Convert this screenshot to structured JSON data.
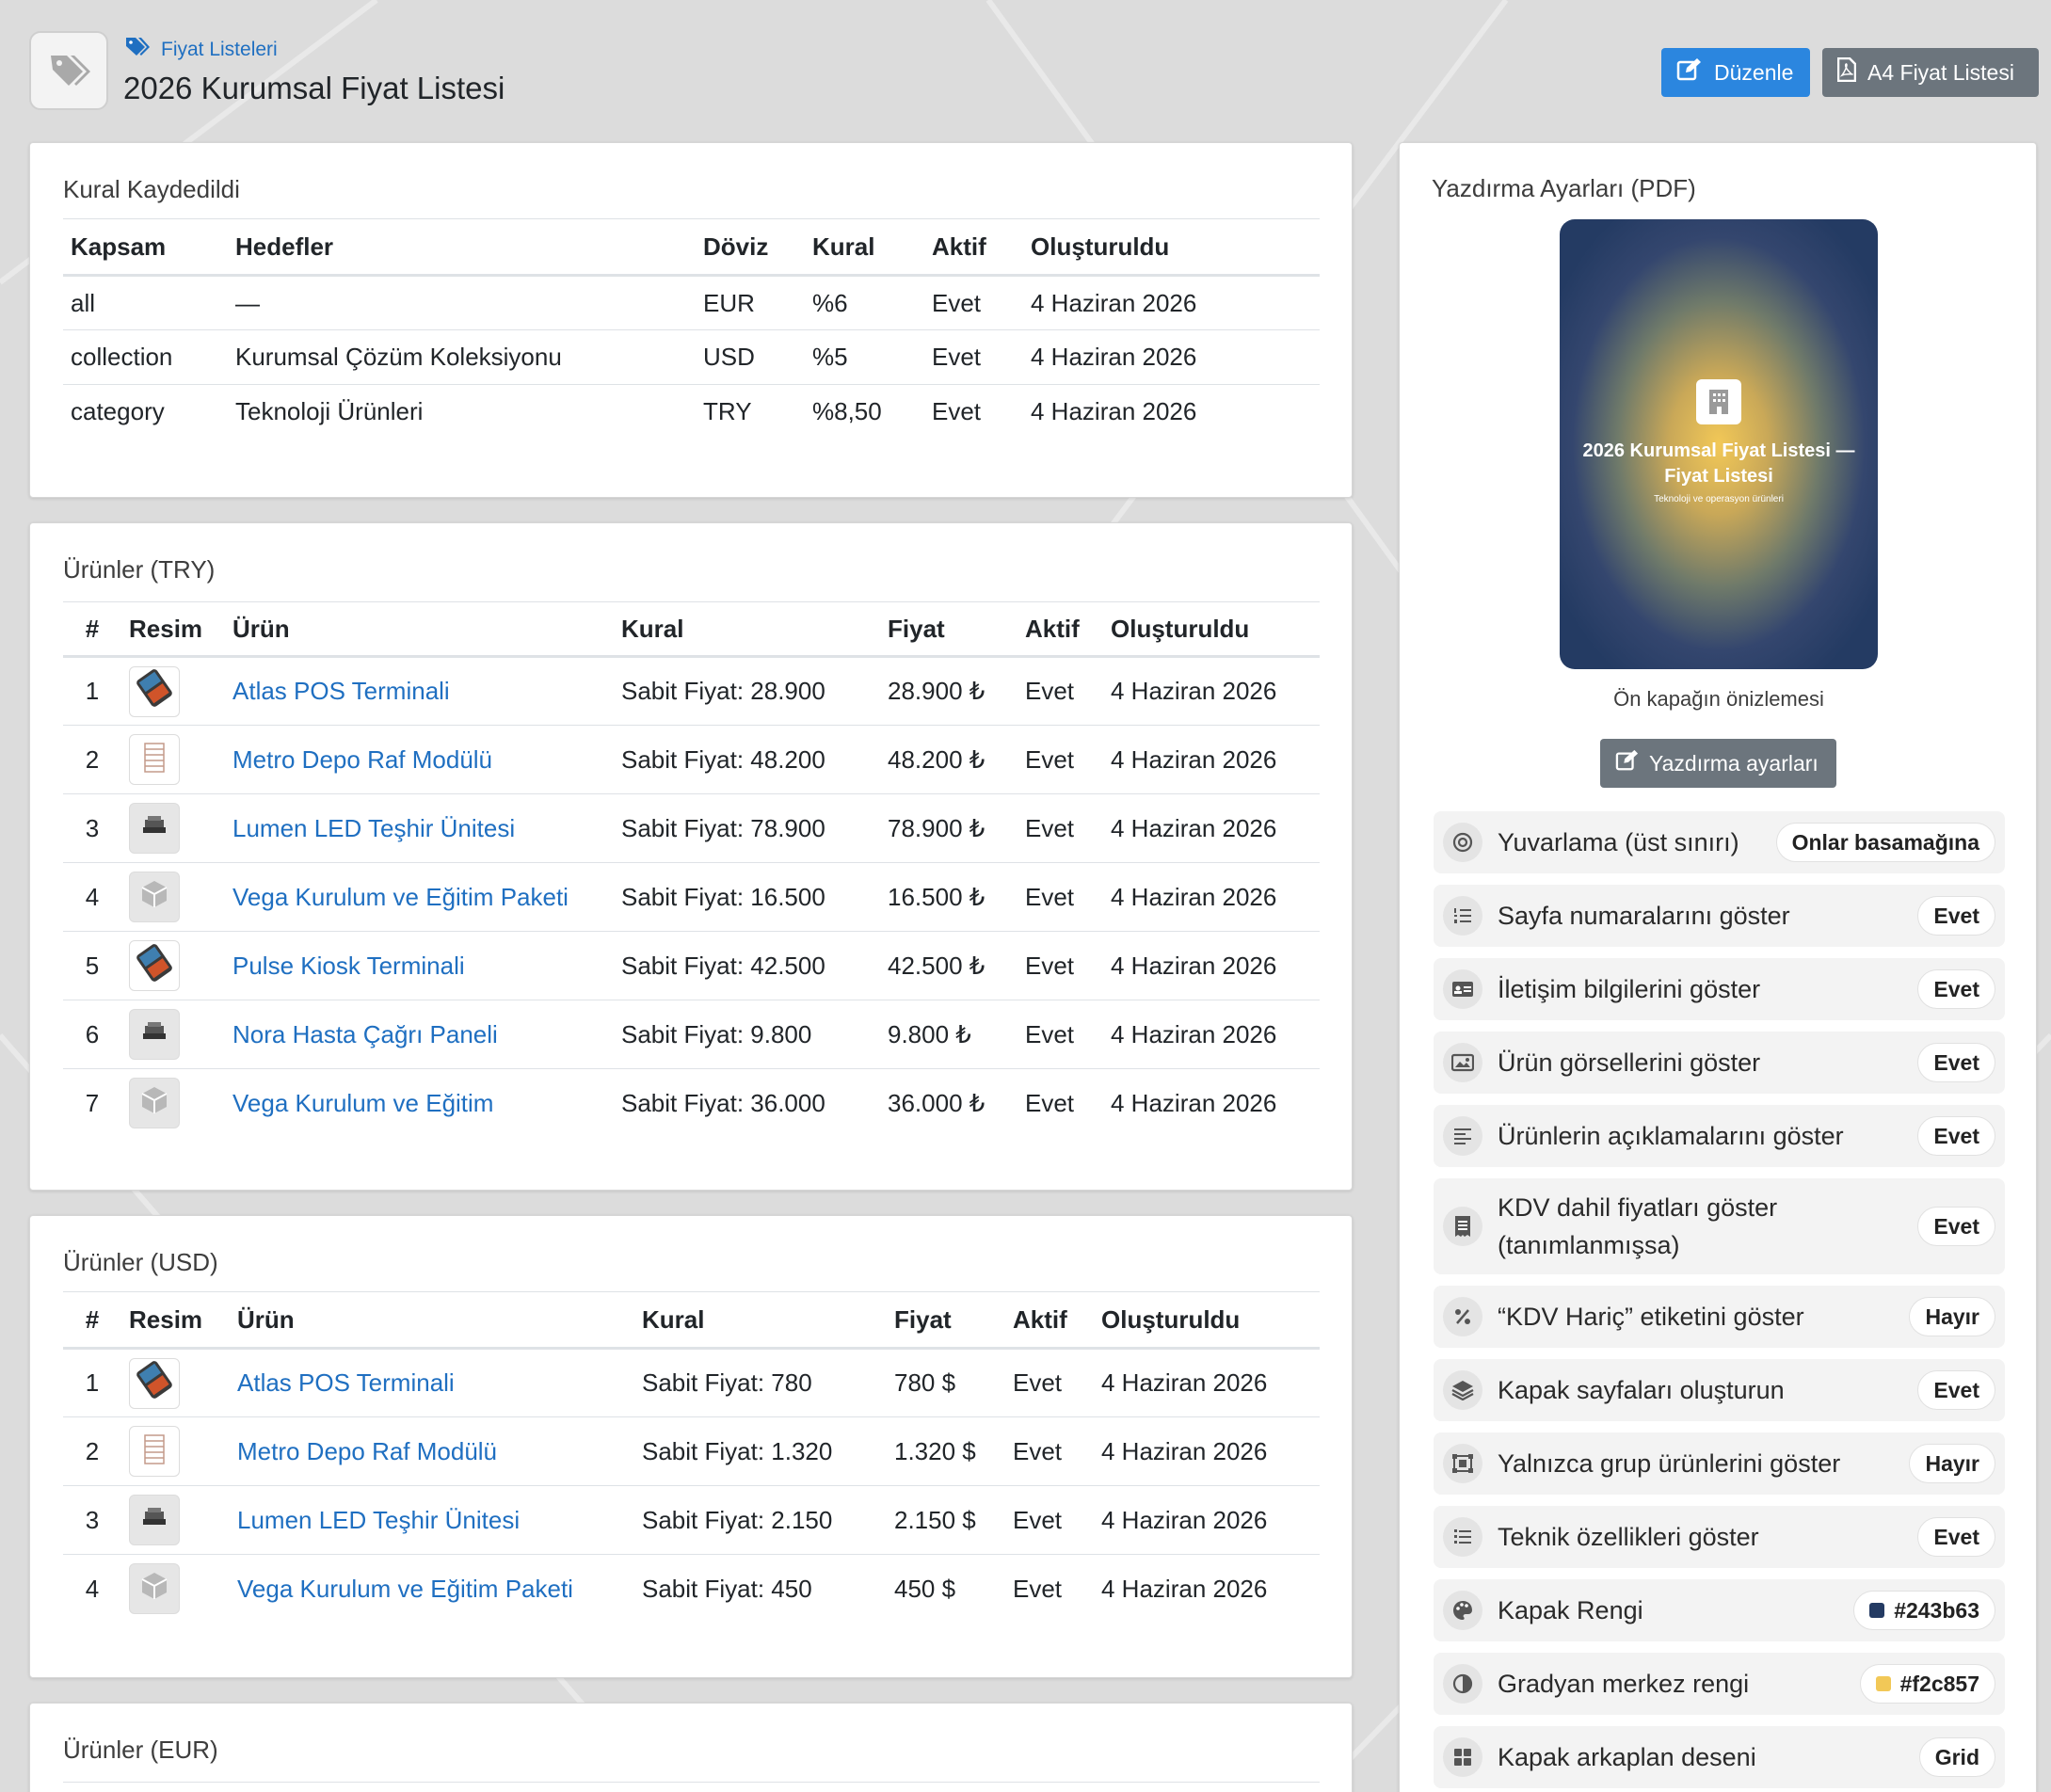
{
  "header": {
    "breadcrumb": "Fiyat Listeleri",
    "title": "2026 Kurumsal Fiyat Listesi",
    "edit_label": "Düzenle",
    "a4_label": "A4 Fiyat Listesi"
  },
  "rules": {
    "title": "Kural Kaydedildi",
    "columns": [
      "Kapsam",
      "Hedefler",
      "Döviz",
      "Kural",
      "Aktif",
      "Oluşturuldu"
    ],
    "rows": [
      [
        "all",
        "—",
        "EUR",
        "%6",
        "Evet",
        "4 Haziran 2026"
      ],
      [
        "collection",
        "Kurumsal Çözüm Koleksiyonu",
        "USD",
        "%5",
        "Evet",
        "4 Haziran 2026"
      ],
      [
        "category",
        "Teknoloji Ürünleri",
        "TRY",
        "%8,50",
        "Evet",
        "4 Haziran 2026"
      ]
    ]
  },
  "products_try": {
    "title": "Ürünler (TRY)",
    "columns": [
      "#",
      "Resim",
      "Ürün",
      "Kural",
      "Fiyat",
      "Aktif",
      "Oluşturuldu"
    ],
    "rows": [
      {
        "n": "1",
        "img": "pos",
        "name": "Atlas POS Terminali",
        "rule": "Sabit Fiyat: 28.900",
        "price": "28.900 ₺",
        "active": "Evet",
        "created": "4 Haziran 2026"
      },
      {
        "n": "2",
        "img": "shelf",
        "name": "Metro Depo Raf Modülü",
        "rule": "Sabit Fiyat: 48.200",
        "price": "48.200 ₺",
        "active": "Evet",
        "created": "4 Haziran 2026"
      },
      {
        "n": "3",
        "img": "led",
        "name": "Lumen LED Teşhir Ünitesi",
        "rule": "Sabit Fiyat: 78.900",
        "price": "78.900 ₺",
        "active": "Evet",
        "created": "4 Haziran 2026"
      },
      {
        "n": "4",
        "img": "box",
        "name": "Vega Kurulum ve Eğitim Paketi",
        "rule": "Sabit Fiyat: 16.500",
        "price": "16.500 ₺",
        "active": "Evet",
        "created": "4 Haziran 2026"
      },
      {
        "n": "5",
        "img": "pos",
        "name": "Pulse Kiosk Terminali",
        "rule": "Sabit Fiyat: 42.500",
        "price": "42.500 ₺",
        "active": "Evet",
        "created": "4 Haziran 2026"
      },
      {
        "n": "6",
        "img": "led",
        "name": "Nora Hasta Çağrı Paneli",
        "rule": "Sabit Fiyat: 9.800",
        "price": "9.800 ₺",
        "active": "Evet",
        "created": "4 Haziran 2026"
      },
      {
        "n": "7",
        "img": "box",
        "name": "Vega Kurulum ve Eğitim",
        "rule": "Sabit Fiyat: 36.000",
        "price": "36.000 ₺",
        "active": "Evet",
        "created": "4 Haziran 2026"
      }
    ]
  },
  "products_usd": {
    "title": "Ürünler (USD)",
    "columns": [
      "#",
      "Resim",
      "Ürün",
      "Kural",
      "Fiyat",
      "Aktif",
      "Oluşturuldu"
    ],
    "rows": [
      {
        "n": "1",
        "img": "pos",
        "name": "Atlas POS Terminali",
        "rule": "Sabit Fiyat: 780",
        "price": "780 $",
        "active": "Evet",
        "created": "4 Haziran 2026"
      },
      {
        "n": "2",
        "img": "shelf",
        "name": "Metro Depo Raf Modülü",
        "rule": "Sabit Fiyat: 1.320",
        "price": "1.320 $",
        "active": "Evet",
        "created": "4 Haziran 2026"
      },
      {
        "n": "3",
        "img": "led",
        "name": "Lumen LED Teşhir Ünitesi",
        "rule": "Sabit Fiyat: 2.150",
        "price": "2.150 $",
        "active": "Evet",
        "created": "4 Haziran 2026"
      },
      {
        "n": "4",
        "img": "box",
        "name": "Vega Kurulum ve Eğitim Paketi",
        "rule": "Sabit Fiyat: 450",
        "price": "450 $",
        "active": "Evet",
        "created": "4 Haziran 2026"
      }
    ]
  },
  "products_eur": {
    "title": "Ürünler (EUR)"
  },
  "print": {
    "title": "Yazdırma Ayarları (PDF)",
    "cover_title": "2026 Kurumsal Fiyat Listesi — Fiyat Listesi",
    "cover_subtitle": "Teknoloji ve operasyon ürünleri",
    "cover_caption": "Ön kapağın önizlemesi",
    "button_label": "Yazdırma ayarları",
    "colors": {
      "cover": "#243b63",
      "gradient": "#f2c857"
    },
    "settings": [
      {
        "icon": "target-icon",
        "label": "Yuvarlama (üst sınırı)",
        "value": "Onlar basamağına"
      },
      {
        "icon": "list-ol-icon",
        "label": "Sayfa numaralarını göster",
        "value": "Evet"
      },
      {
        "icon": "id-card-icon",
        "label": "İletişim bilgilerini göster",
        "value": "Evet"
      },
      {
        "icon": "image-icon",
        "label": "Ürün görsellerini göster",
        "value": "Evet"
      },
      {
        "icon": "align-left-icon",
        "label": "Ürünlerin açıklamalarını göster",
        "value": "Evet"
      },
      {
        "icon": "receipt-icon",
        "label": "KDV dahil fiyatları göster (tanımlanmışsa)",
        "value": "Evet"
      },
      {
        "icon": "percent-icon",
        "label": "“KDV Hariç” etiketini göster",
        "value": "Hayır"
      },
      {
        "icon": "layers-icon",
        "label": "Kapak sayfaları oluşturun",
        "value": "Evet"
      },
      {
        "icon": "object-group-icon",
        "label": "Yalnızca grup ürünlerini göster",
        "value": "Hayır"
      },
      {
        "icon": "list-icon",
        "label": "Teknik özellikleri göster",
        "value": "Evet"
      },
      {
        "icon": "palette-icon",
        "label": "Kapak Rengi",
        "value": "#243b63"
      },
      {
        "icon": "contrast-icon",
        "label": "Gradyan merkez rengi",
        "value": "#f2c857"
      },
      {
        "icon": "grid-icon",
        "label": "Kapak arkaplan deseni",
        "value": "Grid"
      }
    ]
  }
}
